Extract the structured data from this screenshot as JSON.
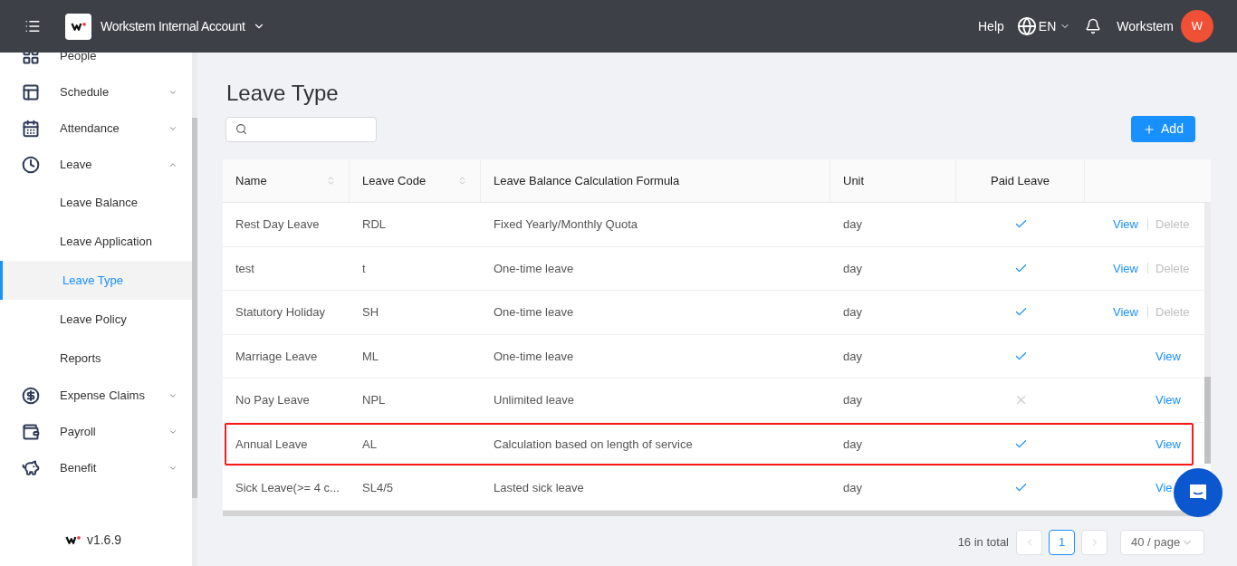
{
  "header": {
    "app_name": "Workstem Internal Account",
    "help": "Help",
    "language": "EN",
    "user_name": "Workstem",
    "avatar": "W"
  },
  "sidebar": {
    "items": [
      {
        "label": "People"
      },
      {
        "label": "Schedule",
        "expanded": false
      },
      {
        "label": "Attendance",
        "expanded": false
      },
      {
        "label": "Leave",
        "expanded": true,
        "children": [
          {
            "label": "Leave Balance",
            "selected": false
          },
          {
            "label": "Leave Application",
            "selected": false
          },
          {
            "label": "Leave Type",
            "selected": true
          },
          {
            "label": "Leave Policy",
            "selected": false
          },
          {
            "label": "Reports",
            "selected": false
          }
        ]
      },
      {
        "label": "Expense Claims",
        "expanded": false
      },
      {
        "label": "Payroll",
        "expanded": false
      },
      {
        "label": "Benefit",
        "expanded": false
      }
    ],
    "version": "v1.6.9"
  },
  "page": {
    "title": "Leave Type",
    "add_button": "Add"
  },
  "table": {
    "columns": [
      {
        "label": "Name",
        "sortable": true
      },
      {
        "label": "Leave Code",
        "sortable": true
      },
      {
        "label": "Leave Balance Calculation Formula",
        "sortable": false
      },
      {
        "label": "Unit",
        "sortable": false
      },
      {
        "label": "Paid Leave",
        "sortable": false
      }
    ],
    "rows": [
      {
        "name": "Rest Day Leave",
        "code": "RDL",
        "formula": "Fixed Yearly/Monthly Quota",
        "unit": "day",
        "paid": true,
        "highlighted": false,
        "actions": [
          {
            "label": "View",
            "disabled": false
          },
          {
            "label": "Delete",
            "disabled": true
          }
        ]
      },
      {
        "name": "test",
        "code": "t",
        "formula": "One-time leave",
        "unit": "day",
        "paid": true,
        "highlighted": false,
        "actions": [
          {
            "label": "View",
            "disabled": false
          },
          {
            "label": "Delete",
            "disabled": true
          }
        ]
      },
      {
        "name": "Statutory Holiday",
        "code": "SH",
        "formula": "One-time leave",
        "unit": "day",
        "paid": true,
        "highlighted": false,
        "actions": [
          {
            "label": "View",
            "disabled": false
          },
          {
            "label": "Delete",
            "disabled": true
          }
        ]
      },
      {
        "name": "Marriage Leave",
        "code": "ML",
        "formula": "One-time leave",
        "unit": "day",
        "paid": true,
        "highlighted": false,
        "actions": [
          {
            "label": "View",
            "disabled": false
          }
        ]
      },
      {
        "name": "No Pay Leave",
        "code": "NPL",
        "formula": "Unlimited leave",
        "unit": "day",
        "paid": false,
        "highlighted": false,
        "actions": [
          {
            "label": "View",
            "disabled": false
          }
        ]
      },
      {
        "name": "Annual Leave",
        "code": "AL",
        "formula": "Calculation based on length of service",
        "unit": "day",
        "paid": true,
        "highlighted": true,
        "actions": [
          {
            "label": "View",
            "disabled": false
          }
        ]
      },
      {
        "name": "Sick Leave(>= 4 c...",
        "code": "SL4/5",
        "formula": "Lasted sick leave",
        "unit": "day",
        "paid": true,
        "highlighted": false,
        "actions": [
          {
            "label": "Vie",
            "disabled": false
          }
        ]
      }
    ]
  },
  "pagination": {
    "total": "16 in total",
    "pages": [
      {
        "label": "1",
        "selected": true
      }
    ],
    "page_size": "40 / page"
  }
}
